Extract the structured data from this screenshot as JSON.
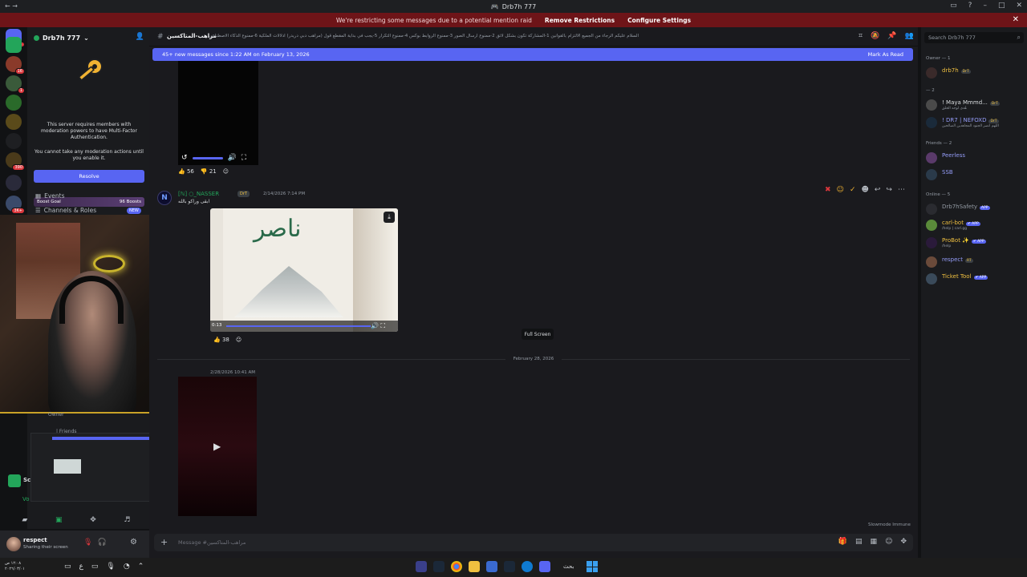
{
  "titlebar": {
    "title": "Drb7h 777"
  },
  "banner": {
    "message": "We're restricting some messages due to a potential mention raid",
    "remove_link": "Remove Restrictions",
    "configure_link": "Configure Settings"
  },
  "server": {
    "name": "Drb7h 777",
    "mfa_notice": "This server requires members with moderation powers to have Multi-Factor Authentication.",
    "mfa_warning": "You cannot take any moderation actions until you enable it.",
    "resolve_label": "Resolve",
    "boost_goal_label": "Boost Goal",
    "boost_count": "96 Boosts",
    "events_label": "Events",
    "channels_roles_label": "Channels & Roles",
    "new_badge": "NEW",
    "owner_label": "Owner",
    "friends_label": "| Friends",
    "voice_label": "Vo"
  },
  "server_rail": {
    "badges": [
      "16",
      "1",
      "390",
      "3K+"
    ]
  },
  "user": {
    "name": "respect",
    "status": "Sharing their screen"
  },
  "chat": {
    "channel_name": "مراهب-المتاكسين",
    "topic": "السلام عليكم الرجاء من الجميع الالتزام بالقوانين 1-المشاركة تكون بشكل لائق 2-ممنوع ارسال الصور 3-ممنوع الروابط بوكس 4-ممنوع التكرار 5-يجب في بداية المقطع قول (مراهب دبي دريدر) ادلالات الملكية 6-ممنوع الذكاء الاصطناعي",
    "new_messages": "45+ new messages since 1:22 AM on February 13, 2026",
    "mark_as_read": "Mark As Read",
    "reactions_1": {
      "count_a": "56",
      "count_b": "21"
    },
    "message_2": {
      "author": "[ℕ] ○_NASSER",
      "badge": "DrT",
      "time": "2/14/2026 7:14 PM",
      "text": "ابقى وراكو بالله",
      "video_time": "0:13",
      "video_overlay_text": "ناصر",
      "tooltip": "Full Screen",
      "reaction_count": "38"
    },
    "date_divider": "February 28, 2026",
    "message_3_time": "2/28/2026 10:41 AM",
    "slowmode": "Slowmode Immune",
    "composer_placeholder": "Message #مراهب-المتاكسين"
  },
  "members": {
    "search_placeholder": "Search Drb7h 777",
    "owner_section": "Owner — 1",
    "section_2": "— 2",
    "friends_section": "Friends — 2",
    "online_section": "Online — 5",
    "list": [
      {
        "name": "drb7h",
        "badge": "DrT",
        "color": "#f0c040"
      },
      {
        "name": "! Maya Mmmd...",
        "badge": "DrT",
        "sub": "هُدى لوجه الخلق",
        "color": "#dbdee1"
      },
      {
        "name": "! DR7 | NEFOXD",
        "badge": "DrT",
        "sub": "اللهم انصر الجنود المجاهدين الصالحين",
        "color": "#949cf7"
      },
      {
        "name": "Peerless",
        "color": "#949cf7"
      },
      {
        "name": "SSB",
        "color": "#949cf7"
      },
      {
        "name": "Drb7hSafety",
        "app": "APP",
        "color": "#949ba4"
      },
      {
        "name": "carl-bot",
        "app": "✔ APP",
        "sub": "/help | carl.gg",
        "color": "#f0c040"
      },
      {
        "name": "ProBot ✨",
        "app": "✔ APP",
        "sub": "/help",
        "color": "#f0c040"
      },
      {
        "name": "respect",
        "badge": "RT",
        "color": "#949cf7"
      },
      {
        "name": "Ticket Tool",
        "app": "✔ APP",
        "color": "#f0c040"
      }
    ]
  },
  "taskbar": {
    "clock": "١٢:٠٨ ص",
    "date": "٢٠٢٦/٠٣/٠١",
    "search_label": "بحث"
  }
}
